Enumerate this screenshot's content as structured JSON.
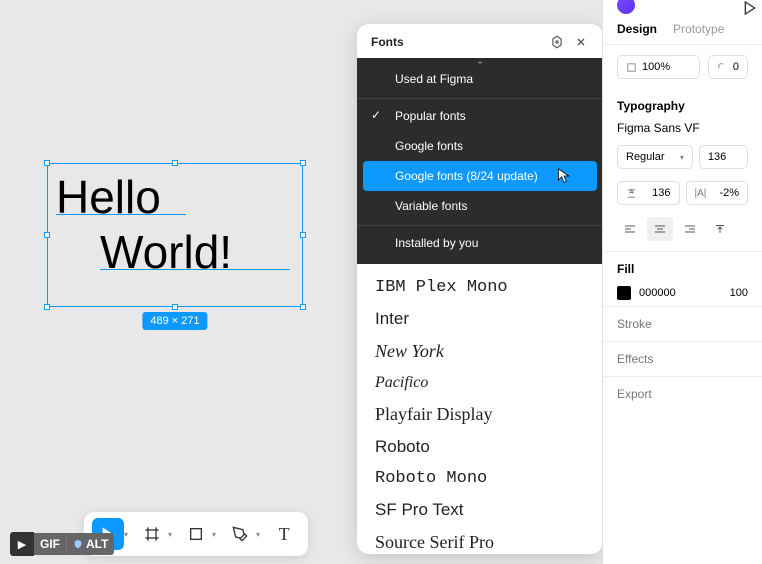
{
  "canvas": {
    "text_line1": "Hello",
    "text_line2": "World!",
    "selection_size": "489 × 271"
  },
  "font_panel": {
    "title": "Fonts",
    "filter_header": "Used at Figma",
    "filters": [
      {
        "label": "Popular fonts",
        "checked": true
      },
      {
        "label": "Google fonts",
        "checked": false
      },
      {
        "label": "Google fonts (8/24 update)",
        "checked": false,
        "selected": true
      },
      {
        "label": "Variable fonts",
        "checked": false
      }
    ],
    "installed_label": "Installed by you",
    "fonts": [
      {
        "name": "IBM Plex Mono",
        "class": "font-mono"
      },
      {
        "name": "Inter",
        "class": ""
      },
      {
        "name": "New York",
        "class": "font-serif-ny"
      },
      {
        "name": "Pacifico",
        "class": "font-script"
      },
      {
        "name": "Playfair Display",
        "class": "font-playfair"
      },
      {
        "name": "Roboto",
        "class": ""
      },
      {
        "name": "Roboto Mono",
        "class": "font-mono"
      },
      {
        "name": "SF Pro Text",
        "class": ""
      },
      {
        "name": "Source Serif Pro",
        "class": "font-serif"
      }
    ]
  },
  "sidebar": {
    "tabs": {
      "design": "Design",
      "prototype": "Prototype"
    },
    "zoom": "100%",
    "corner": "0",
    "typography": {
      "title": "Typography",
      "font_family": "Figma Sans VF",
      "weight": "Regular",
      "size": "136",
      "line_height": "136",
      "letter_spacing": "-2%"
    },
    "fill": {
      "title": "Fill",
      "hex": "000000",
      "opacity": "100"
    },
    "stroke": "Stroke",
    "effects": "Effects",
    "export": "Export"
  },
  "badges": {
    "gif": "GIF",
    "alt": "ALT"
  }
}
